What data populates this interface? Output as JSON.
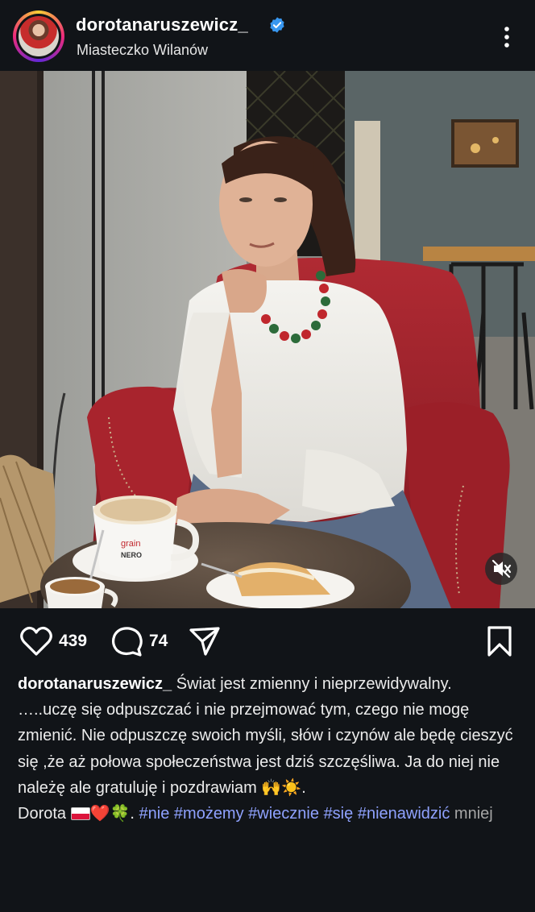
{
  "header": {
    "username": "dorotanaruszewicz_",
    "location": "Miasteczko Wilanów",
    "verified_icon": "verified-badge-icon",
    "more_icon": "vertical-ellipsis-icon"
  },
  "photo": {
    "cup_brand_top": "grain",
    "cup_brand_bottom": "NERO",
    "mute_icon": "speaker-muted-icon"
  },
  "actions": {
    "like_icon": "heart-icon",
    "like_count": "439",
    "comment_icon": "comment-icon",
    "comment_count": "74",
    "share_icon": "send-icon",
    "save_icon": "bookmark-icon"
  },
  "caption": {
    "username": "dorotanaruszewicz_",
    "line1": "Świat jest zmienny i nieprzewidywalny.",
    "line2": "…..uczę się odpuszczać i nie przejmować tym, czego nie mogę zmienić. Nie odpuszczę swoich myśli, słów i czynów ale będę cieszyć się ,że aż połowa społeczeństwa jest dziś szczęśliwa. Ja do niej nie należę ale gratuluję i pozdrawiam",
    "line2_emoji": "🙌☀️",
    "line2_end": ".",
    "signature": "Dorota",
    "signature_emoji": "❤️🍀",
    "signature_end": ".",
    "hashtags": [
      "#nie",
      "#możemy",
      "#wiecznie",
      "#się",
      "#nienawidzić"
    ],
    "more_label": "mniej"
  },
  "colors": {
    "background": "#111418",
    "hashtag": "#8fa2ff",
    "verified": "#3897f0",
    "armchair": "#a3222b"
  }
}
